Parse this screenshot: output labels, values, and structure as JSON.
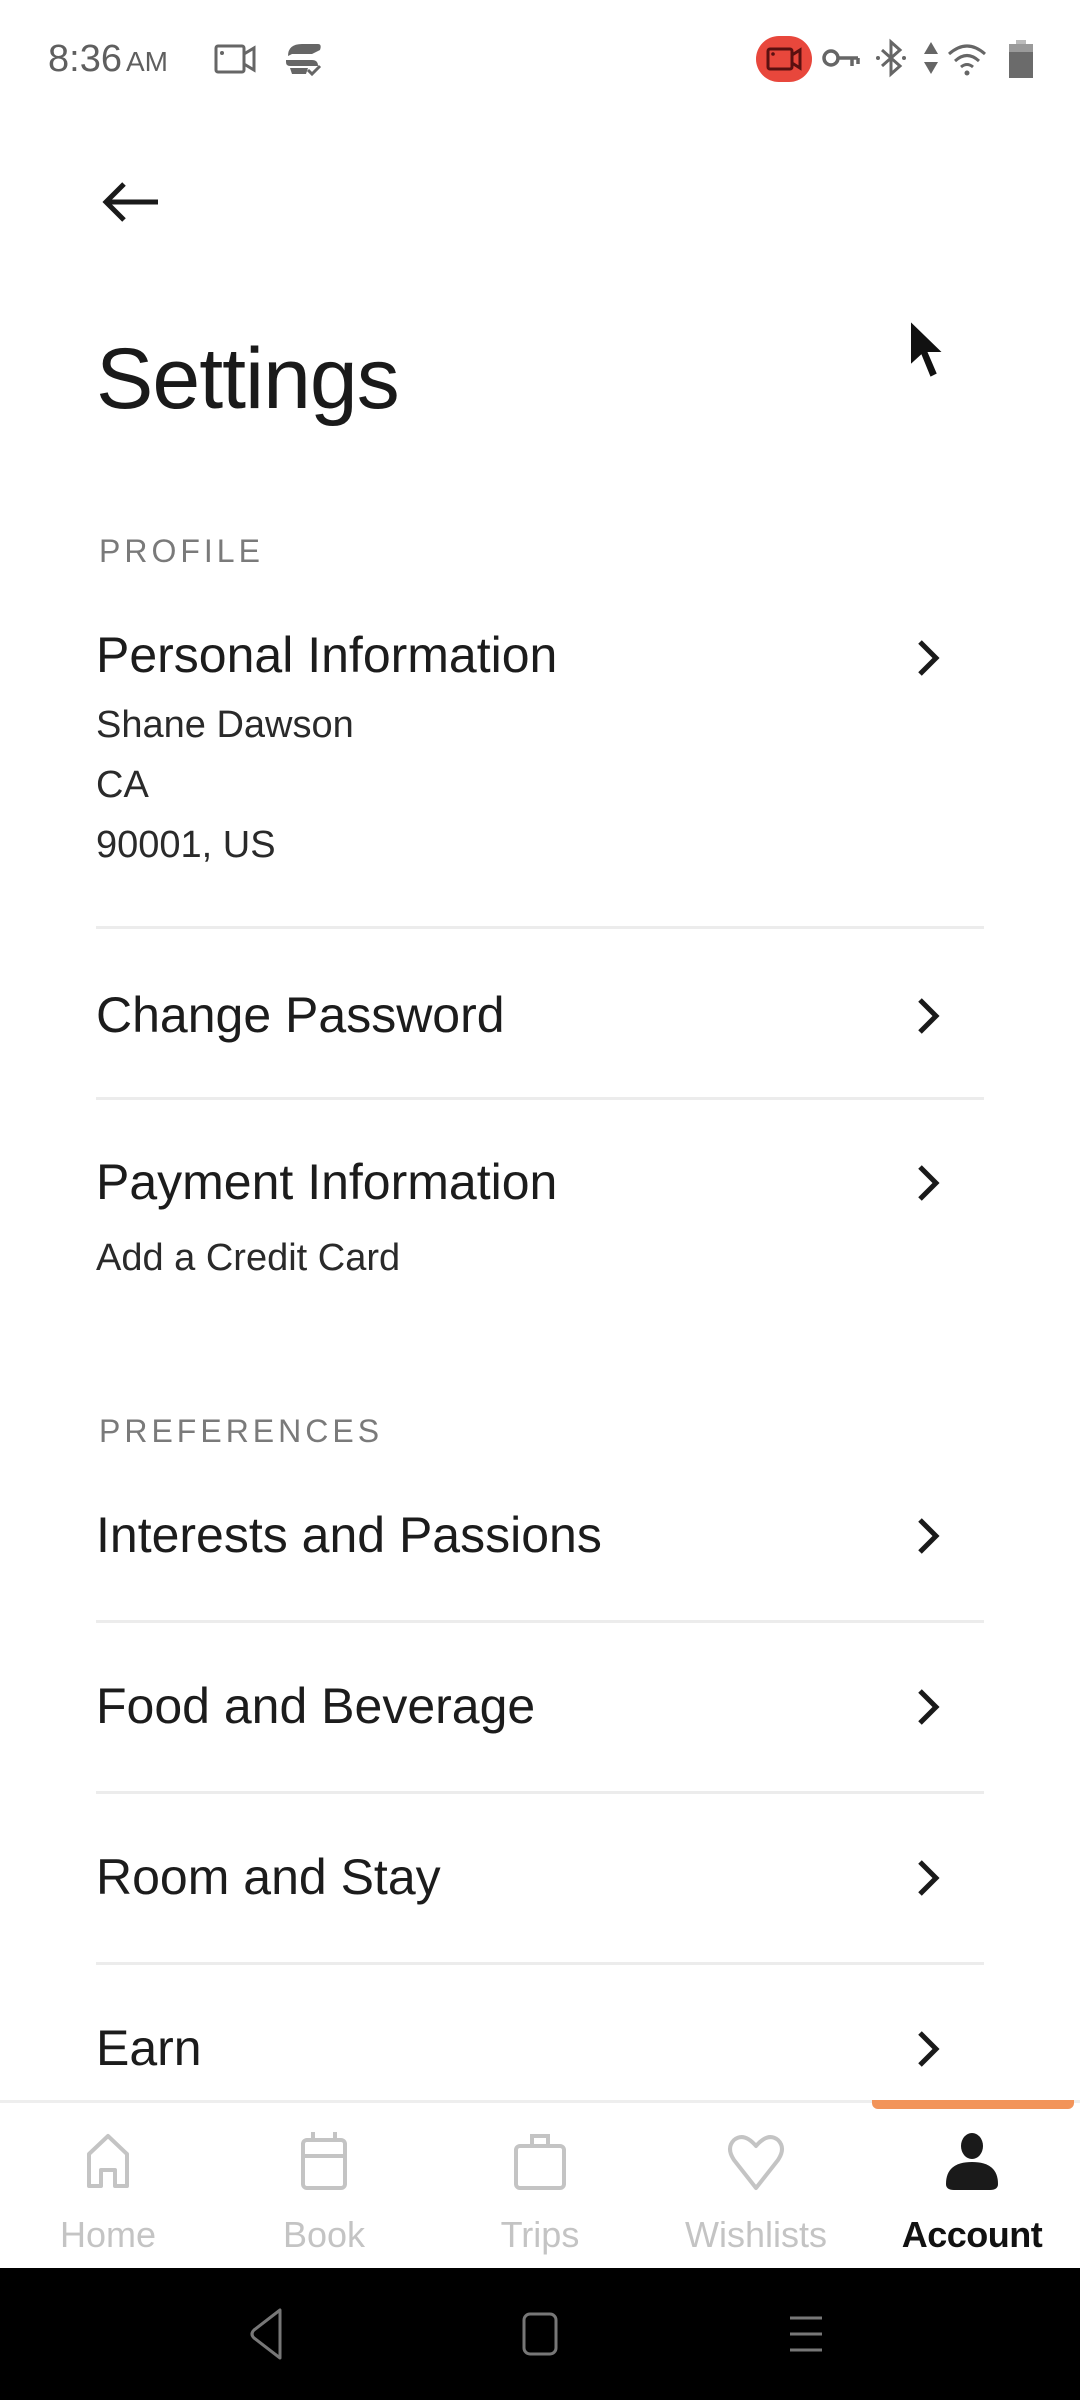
{
  "status_bar": {
    "time": "8:36",
    "ampm": "AM",
    "icons": [
      "screen-record-icon",
      "sync-check-icon",
      "recording-indicator-icon",
      "vpn-key-icon",
      "bluetooth-icon",
      "data-arrows-icon",
      "wifi-icon",
      "battery-icon"
    ],
    "recording_color": "#e8473c"
  },
  "header": {
    "back_icon": "arrow-left-icon",
    "title": "Settings"
  },
  "sections": {
    "profile": {
      "label": "PROFILE",
      "items": [
        {
          "title": "Personal Information",
          "lines": [
            "Shane Dawson",
            "CA",
            "90001, US"
          ]
        },
        {
          "title": "Change Password"
        },
        {
          "title": "Payment Information",
          "lines": [
            "Add a Credit Card"
          ]
        }
      ]
    },
    "preferences": {
      "label": "PREFERENCES",
      "items": [
        {
          "title": "Interests and Passions"
        },
        {
          "title": "Food and Beverage"
        },
        {
          "title": "Room and Stay"
        },
        {
          "title": "Earn"
        }
      ]
    }
  },
  "bottom_nav": {
    "accent_color": "#f2945a",
    "active": "Account",
    "tabs": [
      {
        "label": "Home",
        "icon": "home-icon"
      },
      {
        "label": "Book",
        "icon": "calendar-icon"
      },
      {
        "label": "Trips",
        "icon": "suitcase-icon"
      },
      {
        "label": "Wishlists",
        "icon": "heart-icon"
      },
      {
        "label": "Account",
        "icon": "person-icon"
      }
    ]
  },
  "system_nav": [
    "back",
    "home",
    "recents"
  ]
}
